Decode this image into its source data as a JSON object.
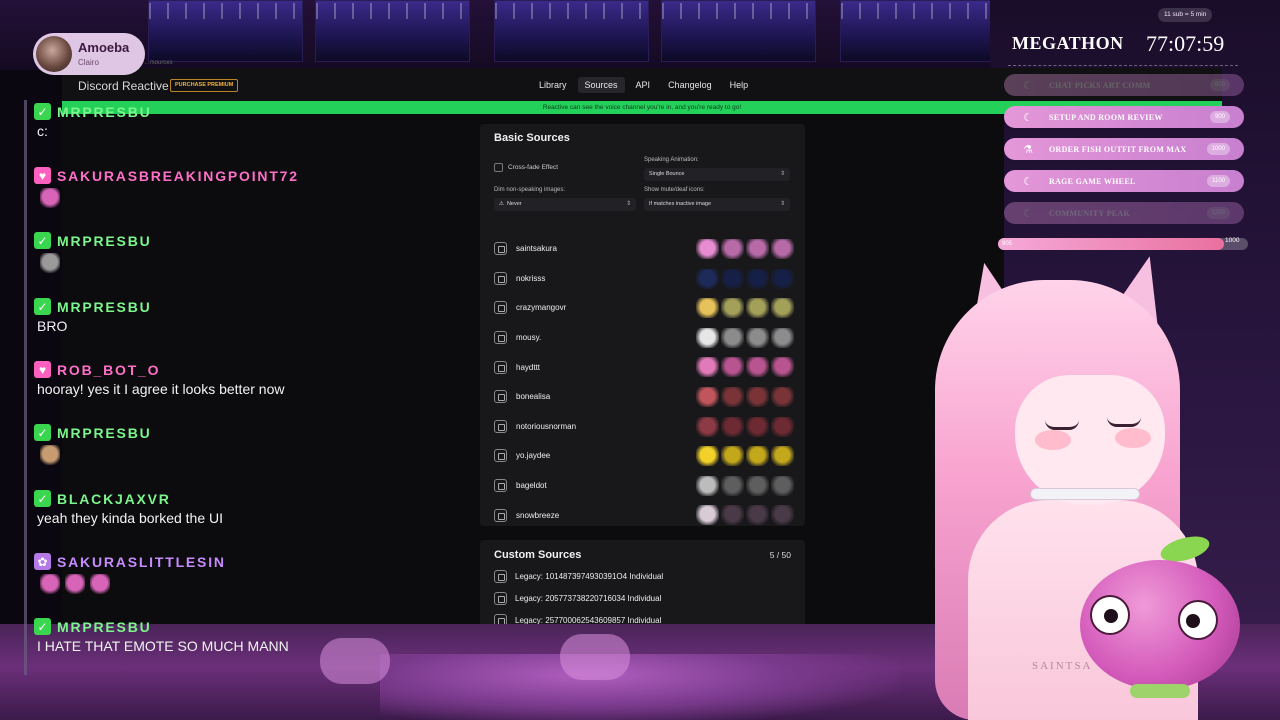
{
  "streamer": {
    "name": "Amoeba",
    "subtitle": "Clairo"
  },
  "app": {
    "url_stub": "…/sources",
    "title": "Discord Reactive",
    "premium_label": "PURCHASE PREMIUM",
    "nav": [
      {
        "label": "Library",
        "active": false
      },
      {
        "label": "Sources",
        "active": true
      },
      {
        "label": "API",
        "active": false
      },
      {
        "label": "Changelog",
        "active": false
      },
      {
        "label": "Help",
        "active": false
      }
    ],
    "status_banner": "Reactive can see the voice channel you're in, and you're ready to go!"
  },
  "basic_sources": {
    "title": "Basic Sources",
    "crossfade_label": "Cross-fade Effect",
    "crossfade_checked": false,
    "speaking_animation_label": "Speaking Animation:",
    "speaking_animation_value": "Single Bounce",
    "dim_label": "Dim non-speaking images:",
    "dim_value": "Never",
    "mute_label": "Show mute/deaf icons:",
    "mute_value": "If matches inactive image",
    "sources": [
      {
        "name": "saintsakura",
        "colors": [
          "#e88cd2",
          "#b86aa8",
          "#b86aa8",
          "#b86aa8"
        ]
      },
      {
        "name": "nokrisss",
        "colors": [
          "#1e2a5a",
          "#162046",
          "#162046",
          "#162046"
        ]
      },
      {
        "name": "crazymangovr",
        "colors": [
          "#e6c25a",
          "#a3a05a",
          "#a3a05a",
          "#a3a05a"
        ]
      },
      {
        "name": "mousy.",
        "colors": [
          "#e6e6e6",
          "#8c8c8c",
          "#8c8c8c",
          "#8c8c8c"
        ]
      },
      {
        "name": "haydttt",
        "colors": [
          "#e07ab8",
          "#b8548f",
          "#b8548f",
          "#b8548f"
        ]
      },
      {
        "name": "bonealisa",
        "colors": [
          "#c0565c",
          "#7a3438",
          "#7a3438",
          "#7a3438"
        ]
      },
      {
        "name": "notoriousnorman",
        "colors": [
          "#8e3a44",
          "#6e2a32",
          "#6e2a32",
          "#6e2a32"
        ]
      },
      {
        "name": "yo.jaydee",
        "colors": [
          "#f2d22a",
          "#c4a81c",
          "#c4a81c",
          "#c4a81c"
        ]
      },
      {
        "name": "bageldot",
        "colors": [
          "#bcbcbc",
          "#5e5e5e",
          "#5e5e5e",
          "#5e5e5e"
        ]
      },
      {
        "name": "snowbreeze",
        "colors": [
          "#d9cbd6",
          "#4a3a48",
          "#4a3a48",
          "#4a3a48"
        ]
      }
    ]
  },
  "custom_sources": {
    "title": "Custom Sources",
    "count": "5 / 50",
    "rows": [
      "Legacy: 1014873974930391O4 Individual",
      "Legacy: 205773738220716034 Individual",
      "Legacy: 257700062543609857 Individual"
    ]
  },
  "chat": [
    {
      "user": "MRPRESBU",
      "color": "#7cf58c",
      "badge": "✓",
      "badge_color": "#3ad64f",
      "text": "c:",
      "emote": null
    },
    {
      "user": "SAKURASBREAKINGPOINT72",
      "color": "#ff6fc8",
      "badge": "♥",
      "badge_color": "#ff5fbf",
      "text": null,
      "emote": "#d864b8"
    },
    {
      "user": "MRPRESBU",
      "color": "#7cf58c",
      "badge": "✓",
      "badge_color": "#3ad64f",
      "text": null,
      "emote": "#9a9a9a"
    },
    {
      "user": "MRPRESBU",
      "color": "#7cf58c",
      "badge": "✓",
      "badge_color": "#3ad64f",
      "text": "BRO",
      "emote": null
    },
    {
      "user": "ROB_BOT_O",
      "color": "#ff6fc8",
      "badge": "♥",
      "badge_color": "#ff5fbf",
      "text": "hooray! yes it I agree it looks better now",
      "emote": null
    },
    {
      "user": "MRPRESBU",
      "color": "#7cf58c",
      "badge": "✓",
      "badge_color": "#3ad64f",
      "text": null,
      "emote": "#c69c70"
    },
    {
      "user": "BLACKJAXVR",
      "color": "#7cf58c",
      "badge": "✓",
      "badge_color": "#3ad64f",
      "text": "yeah they kinda borked the UI",
      "emote": null
    },
    {
      "user": "SAKURASLITTLESIN",
      "color": "#c78bff",
      "badge": "✿",
      "badge_color": "#b57ae8",
      "text": null,
      "emote": "#d864b8"
    },
    {
      "user": "MRPRESBU",
      "color": "#7cf58c",
      "badge": "✓",
      "badge_color": "#3ad64f",
      "text": "I HATE THAT EMOTE SO MUCH MANN",
      "emote": null
    }
  ],
  "megathon": {
    "title": "MEGATHON",
    "timer": "77:07:59",
    "rate": "11 sub = 5 min",
    "goals": [
      {
        "label": "CHAT PICKS ART COMM",
        "value": "800",
        "icon": "☾",
        "faded": true
      },
      {
        "label": "SETUP AND ROOM REVIEW",
        "value": "900",
        "icon": "☾",
        "faded": false
      },
      {
        "label": "ORDER FISH OUTFIT FROM MAX",
        "value": "1000",
        "icon": "⚗",
        "faded": false
      },
      {
        "label": "RAGE GAME WHEEL",
        "value": "1100",
        "icon": "☾",
        "faded": false
      },
      {
        "label": "COMMUNITY PEAK",
        "value": "1200",
        "icon": "☾",
        "faded": true
      }
    ],
    "progress_start": "905",
    "progress_end": "1000",
    "progress_fraction": 0.905
  },
  "avatar_shirt_text": "SAINTSA"
}
